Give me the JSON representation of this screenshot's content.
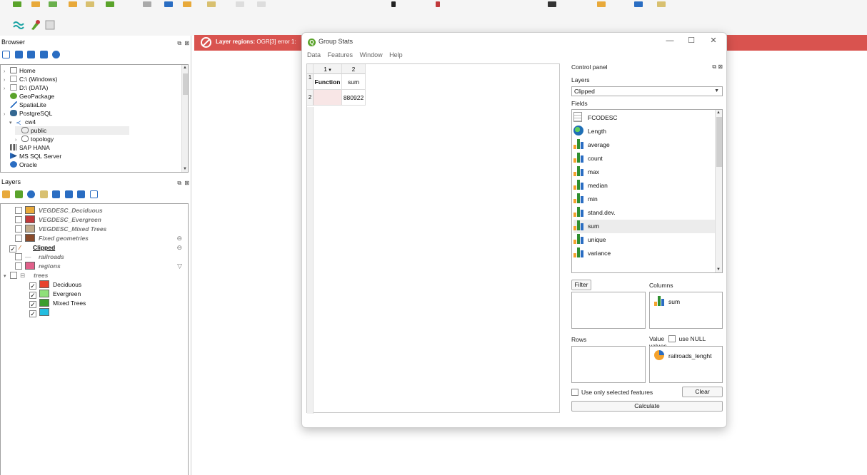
{
  "colors": {
    "message_bar": "#d9534f",
    "accent": "#5aa32b"
  },
  "browser": {
    "title": "Browser",
    "items": [
      {
        "label": "Home",
        "icon": "home-icon"
      },
      {
        "label": "C:\\ (Windows)",
        "icon": "folder-icon"
      },
      {
        "label": "D:\\ (DATA)",
        "icon": "folder-icon"
      },
      {
        "label": "GeoPackage",
        "icon": "geopackage-icon"
      },
      {
        "label": "SpatiaLite",
        "icon": "spatialite-icon"
      },
      {
        "label": "PostgreSQL",
        "icon": "postgresql-icon"
      },
      {
        "label": "cw4",
        "icon": "connection-icon"
      },
      {
        "label": "public",
        "icon": "schema-icon"
      },
      {
        "label": "topology",
        "icon": "schema-icon"
      },
      {
        "label": "SAP HANA",
        "icon": "sap-hana-icon"
      },
      {
        "label": "MS SQL Server",
        "icon": "mssql-icon"
      },
      {
        "label": "Oracle",
        "icon": "oracle-icon"
      }
    ]
  },
  "layers": {
    "title": "Layers",
    "items": [
      {
        "label": "VEGDESC_Deciduous",
        "checked": false,
        "swatch": "#e8a93a",
        "style": "italic"
      },
      {
        "label": "VEGDESC_Evergreen",
        "checked": false,
        "swatch": "#c0393b",
        "style": "italic"
      },
      {
        "label": "VEGDESC_Mixed Trees",
        "checked": false,
        "swatch": "#bfa98a",
        "style": "italic"
      },
      {
        "label": "Fixed geometries",
        "checked": false,
        "swatch": "#8a4a2a",
        "style": "italic"
      },
      {
        "label": "Clipped",
        "checked": true,
        "swatch": "#d07a3a",
        "style": "bold"
      },
      {
        "label": "railroads",
        "checked": false,
        "swatch": "#999999",
        "style": "italic"
      },
      {
        "label": "regions",
        "checked": false,
        "swatch": "#e0608a",
        "style": "italic"
      },
      {
        "label": "trees",
        "checked": false,
        "swatch": "#ffffff",
        "style": "italic"
      },
      {
        "label": "Deciduous",
        "checked": true,
        "swatch": "#e8412e",
        "style": "normal"
      },
      {
        "label": "Evergreen",
        "checked": true,
        "swatch": "#8fe07a",
        "style": "normal"
      },
      {
        "label": "Mixed Trees",
        "checked": true,
        "swatch": "#3a9e2e",
        "style": "normal"
      },
      {
        "label": "",
        "checked": true,
        "swatch": "#22bde0",
        "style": "normal"
      }
    ]
  },
  "message": {
    "title": "Layer regions:",
    "detail": "OGR[3] error 1:"
  },
  "dialog": {
    "title": "Group Stats",
    "menu": [
      "Data",
      "Features",
      "Window",
      "Help"
    ],
    "table": {
      "col_headers": [
        "1",
        "2"
      ],
      "row_headers": [
        "1",
        "2"
      ],
      "rows": [
        [
          "Function",
          "sum"
        ],
        [
          "",
          "880922"
        ]
      ]
    },
    "control_panel": {
      "title": "Control panel",
      "layers_label": "Layers",
      "layer_selected": "Clipped",
      "fields_label": "Fields",
      "fields": [
        {
          "name": "FCODESC",
          "icon": "text-field-icon"
        },
        {
          "name": "Length",
          "icon": "globe-icon"
        },
        {
          "name": "average",
          "icon": "bar-chart-icon"
        },
        {
          "name": "count",
          "icon": "bar-chart-icon"
        },
        {
          "name": "max",
          "icon": "bar-chart-icon"
        },
        {
          "name": "median",
          "icon": "bar-chart-icon"
        },
        {
          "name": "min",
          "icon": "bar-chart-icon"
        },
        {
          "name": "stand.dev.",
          "icon": "bar-chart-icon"
        },
        {
          "name": "sum",
          "icon": "bar-chart-icon"
        },
        {
          "name": "unique",
          "icon": "bar-chart-icon"
        },
        {
          "name": "variance",
          "icon": "bar-chart-icon"
        }
      ],
      "filter_label": "Filter",
      "columns_label": "Columns",
      "columns_value": "sum",
      "rows_label": "Rows",
      "value_label": "Value",
      "use_null_label": "use NULL values",
      "value_field": "railroads_lenght",
      "selected_only_label": "Use only selected features",
      "clear_label": "Clear",
      "calculate_label": "Calculate"
    }
  }
}
